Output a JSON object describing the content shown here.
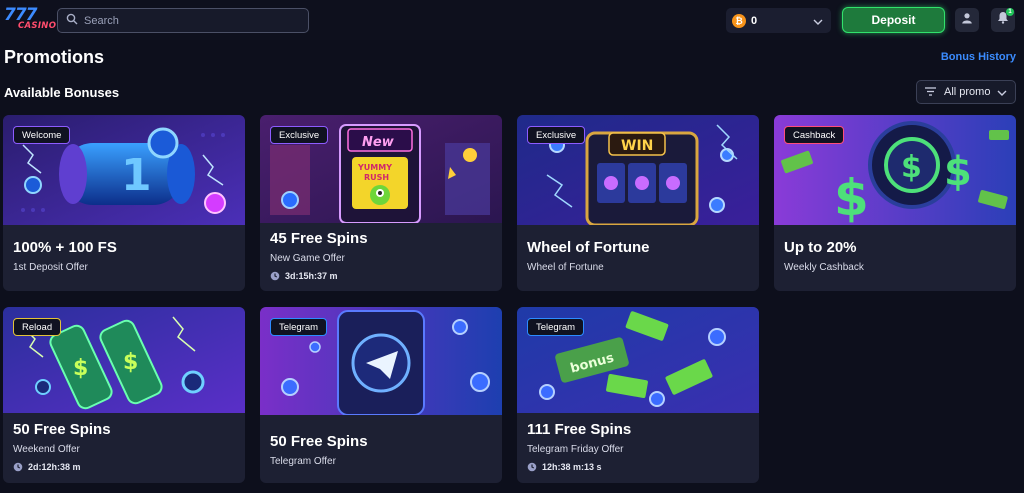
{
  "header": {
    "logo_number": "777",
    "logo_text": "CASINO",
    "search_placeholder": "Search",
    "wallet_currency_symbol": "₿",
    "wallet_amount": "0",
    "deposit_label": "Deposit",
    "notification_count": "1"
  },
  "page": {
    "title": "Promotions",
    "bonus_history_label": "Bonus History",
    "section_title": "Available Bonuses",
    "filter_label": "All promo"
  },
  "cards": [
    {
      "tag": "Welcome",
      "title": "100% + 100 FS",
      "subtitle": "1st Deposit Offer",
      "timer": ""
    },
    {
      "tag": "Exclusive",
      "title": "45 Free Spins",
      "subtitle": "New Game Offer",
      "timer": "3d:15h:37 m"
    },
    {
      "tag": "Exclusive",
      "title": "Wheel of Fortune",
      "subtitle": "Wheel of Fortune",
      "timer": ""
    },
    {
      "tag": "Cashback",
      "title": "Up to 20%",
      "subtitle": "Weekly Cashback",
      "timer": ""
    },
    {
      "tag": "Reload",
      "title": "50 Free Spins",
      "subtitle": "Weekend Offer",
      "timer": "2d:12h:38 m"
    },
    {
      "tag": "Telegram",
      "title": "50 Free Spins",
      "subtitle": "Telegram Offer",
      "timer": ""
    },
    {
      "tag": "Telegram",
      "title": "111 Free Spins",
      "subtitle": "Telegram Friday Offer",
      "timer": "12h:38 m:13 s"
    }
  ],
  "art_labels": {
    "new_sign": "New",
    "yummy": "YUMMY",
    "rush": "RUSH",
    "win": "WIN",
    "bonus": "bonus"
  },
  "colors": {
    "background": "#0d0f1c",
    "card": "#1d2033",
    "accent_blue": "#3b8cff",
    "deposit_green": "#31e26c"
  }
}
